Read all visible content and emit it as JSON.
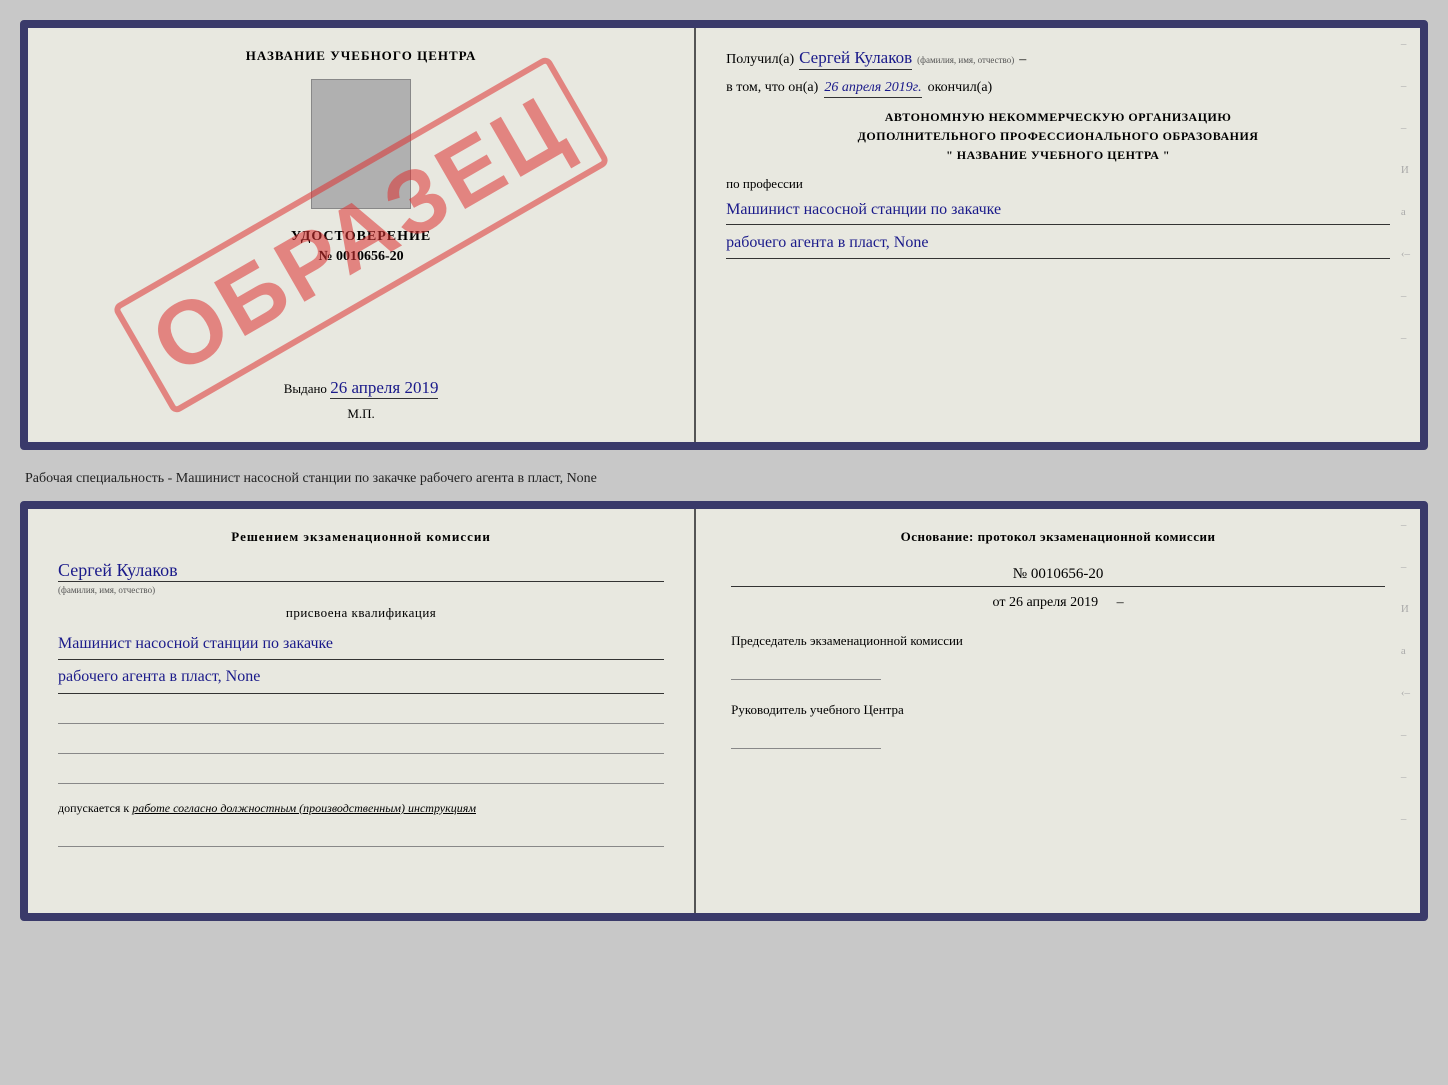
{
  "top_left": {
    "title": "НАЗВАНИЕ УЧЕБНОГО ЦЕНТРА",
    "watermark": "ОБРАЗЕЦ",
    "photo_alt": "фото",
    "udostoverenie": "УДОСТОВЕРЕНИЕ",
    "number": "№ 0010656-20",
    "vydano_label": "Выдано",
    "vydano_date": "26 апреля 2019",
    "mp": "М.П."
  },
  "top_right": {
    "poluchil_label": "Получил(а)",
    "poluchil_name": "Сергей Кулаков",
    "poluchil_hint": "(фамилия, имя, отчество)",
    "dash": "–",
    "vtom_label": "в том, что он(а)",
    "vtom_date": "26 апреля 2019г.",
    "okonchil_label": "окончил(а)",
    "org_line1": "АВТОНОМНУЮ НЕКОММЕРЧЕСКУЮ ОРГАНИЗАЦИЮ",
    "org_line2": "ДОПОЛНИТЕЛЬНОГО ПРОФЕССИОНАЛЬНОГО ОБРАЗОВАНИЯ",
    "org_line3": "\" НАЗВАНИЕ УЧЕБНОГО ЦЕНТРА \"",
    "po_professii": "по профессии",
    "profession1": "Машинист насосной станции по закачке",
    "profession2": "рабочего агента в пласт, None"
  },
  "subtitle": "Рабочая специальность - Машинист насосной станции по закачке рабочего агента в пласт,\nNone",
  "bottom_left": {
    "reshen_title": "Решением экзаменационной комиссии",
    "name": "Сергей Кулаков",
    "name_hint": "(фамилия, имя, отчество)",
    "prisvoena": "присвоена квалификация",
    "qual1": "Машинист насосной станции по закачке",
    "qual2": "рабочего агента в пласт, None",
    "dopuskaetsya_label": "допускается к",
    "dopuskaetsya_text": "работе согласно должностным (производственным) инструкциям"
  },
  "bottom_right": {
    "osnovanie_title": "Основание: протокол экзаменационной комиссии",
    "number": "№ 0010656-20",
    "ot_label": "от",
    "ot_date": "26 апреля 2019",
    "predsedatel_label": "Председатель экзаменационной комиссии",
    "rukovoditel_label": "Руководитель учебного Центра"
  }
}
